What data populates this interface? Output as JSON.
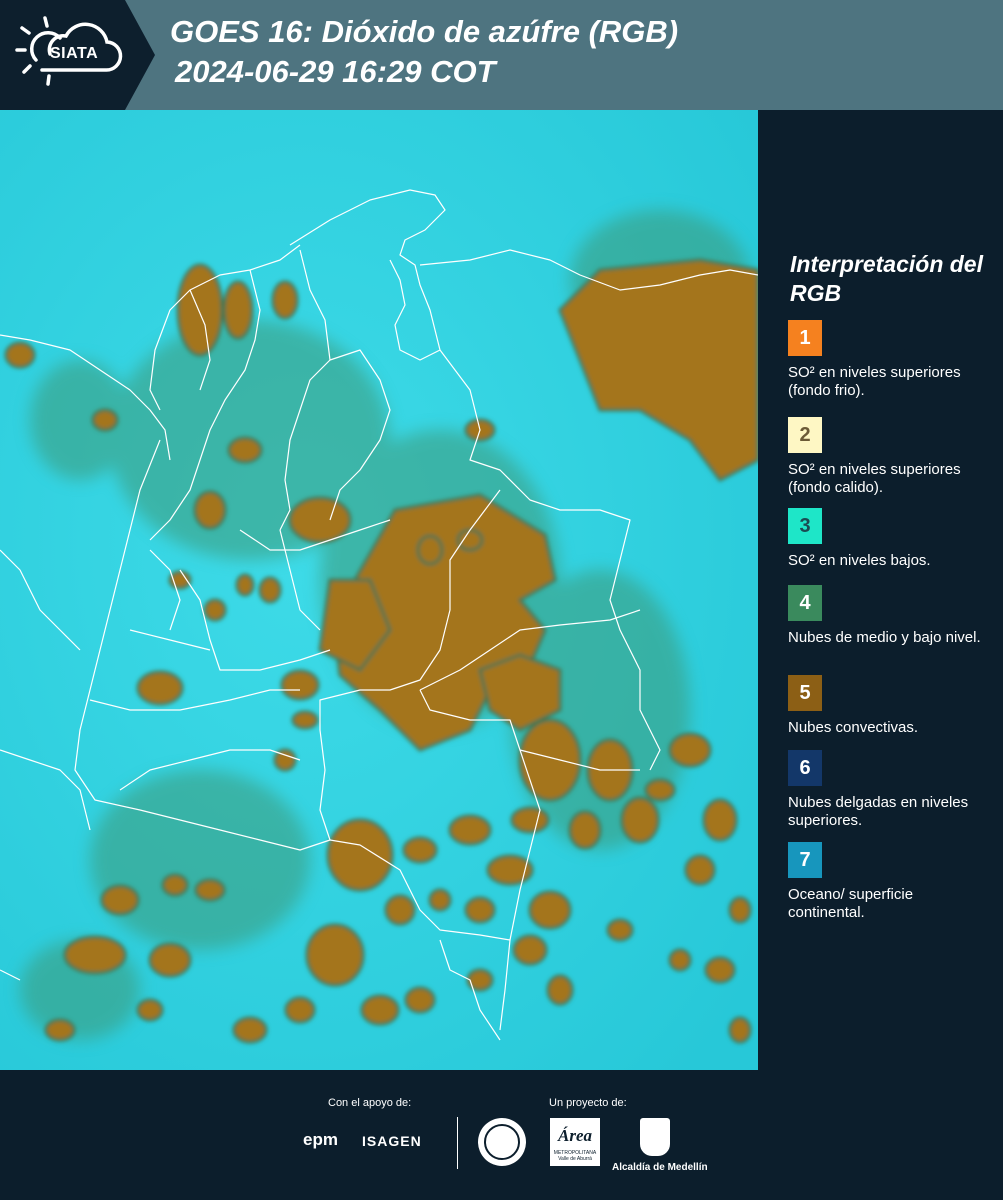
{
  "header": {
    "logo_text": "SIATA",
    "title_line1": "GOES 16: Dióxido de azúfre (RGB)",
    "title_line2": "2024-06-29 16:29 COT"
  },
  "legend": {
    "title": "Interpretación del RGB",
    "items": [
      {
        "number": "1",
        "label": "SO² en niveles superiores (fondo frio).",
        "color": "#f5811f",
        "num_color": "#ffffff"
      },
      {
        "number": "2",
        "label": "SO² en niveles superiores (fondo calido).",
        "color": "#fef7c4",
        "num_color": "#6b5a36"
      },
      {
        "number": "3",
        "label": "SO² en niveles bajos.",
        "color": "#1ee6c8",
        "num_color": "#1b4b52"
      },
      {
        "number": "4",
        "label": "Nubes de medio y bajo nivel.",
        "color": "#3a8a5d",
        "num_color": "#ffffff"
      },
      {
        "number": "5",
        "label": "Nubes convectivas.",
        "color": "#8c5f15",
        "num_color": "#ffffff"
      },
      {
        "number": "6",
        "label": "Nubes delgadas en niveles superiores.",
        "color": "#133769",
        "num_color": "#ffffff"
      },
      {
        "number": "7",
        "label": "Oceano/ superficie continental.",
        "color": "#1796bd",
        "num_color": "#ffffff"
      }
    ]
  },
  "colors": {
    "background_cyan": "#30d3e3",
    "convective_brown": "#a4741f",
    "cloud_green": "#4f8c64",
    "borders": "#ffffff",
    "panel": "#0c1e2c",
    "header": "#4e7480"
  },
  "footer": {
    "support_label": "Con el apoyo de:",
    "project_label": "Un proyecto de:",
    "epm": "epm",
    "isagen": "ISAGEN",
    "area_script": "Área",
    "area_sub1": "METROPOLITANA",
    "area_sub2": "Valle de Aburrá",
    "alcaldia": "Alcaldía de Medellín"
  }
}
